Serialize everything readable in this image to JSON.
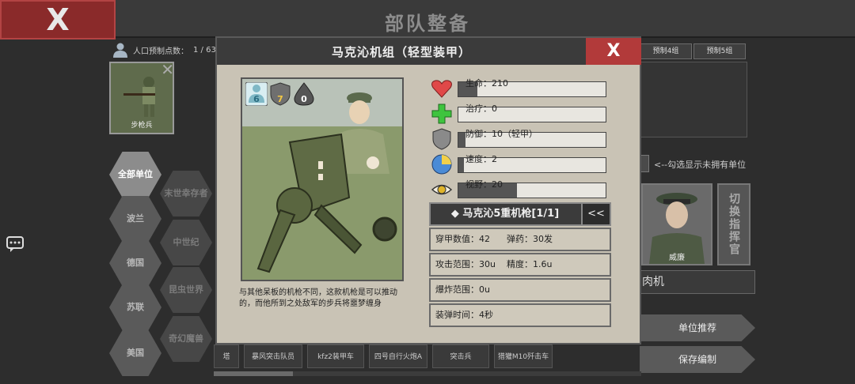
{
  "header": {
    "close_label": "X",
    "title": "部队整备"
  },
  "population": {
    "label": "人口预制点数：",
    "value": "1 / 63"
  },
  "selected_unit": {
    "label": "步枪兵"
  },
  "factions": [
    {
      "label": "全部单位",
      "state": "active"
    },
    {
      "label": "末世幸存者",
      "state": "dim"
    },
    {
      "label": "波兰",
      "state": "normal"
    },
    {
      "label": "中世纪",
      "state": "dim"
    },
    {
      "label": "德国",
      "state": "normal"
    },
    {
      "label": "昆虫世界",
      "state": "dim"
    },
    {
      "label": "苏联",
      "state": "normal"
    },
    {
      "label": "奇幻魔兽",
      "state": "dim"
    },
    {
      "label": "美国",
      "state": "normal"
    }
  ],
  "presets": [
    "预制4组",
    "预制5组"
  ],
  "check_hint": "<--勾选显示未拥有单位",
  "commander": {
    "name": "威廉",
    "switch_label": "切换指挥官"
  },
  "right_name": "肉机",
  "buttons": {
    "recommend": "单位推荐",
    "save": "保存编制"
  },
  "bottom_units": [
    "塔",
    "暴风突击队员",
    "kfz2装甲车",
    "四号自行火炮A",
    "突击兵",
    "猎獾M10歼击车"
  ],
  "modal": {
    "title": "马克沁机组（轻型装甲）",
    "close_label": "X",
    "badges": {
      "population": "6",
      "armor": "7",
      "stealth": "0"
    },
    "description": "与其他呆板的机枪不同，这款机枪是可以推动的，而他所到之处敌军的步兵将噩梦缠身",
    "stats": [
      {
        "label": "生命：210",
        "fill": 0.13,
        "icon": "heart-icon"
      },
      {
        "label": "治疗：0",
        "fill": 0.0,
        "icon": "heal-cross-icon"
      },
      {
        "label": "防御：10（轻甲）",
        "fill": 0.05,
        "icon": "shield-icon"
      },
      {
        "label": "速度：2",
        "fill": 0.04,
        "icon": "speed-pie-icon"
      },
      {
        "label": "视野：20",
        "fill": 0.4,
        "icon": "eye-icon"
      }
    ],
    "weapon": {
      "title": "◆  马克沁5重机枪[1/1]",
      "collapse": "<<",
      "rows": [
        [
          "穿甲数值：42",
          "弹药：30发"
        ],
        [
          "攻击范围：30u",
          "精度：1.6u"
        ],
        [
          "爆炸范围：0u",
          ""
        ],
        [
          "装弹时间：4秒",
          ""
        ]
      ]
    }
  }
}
